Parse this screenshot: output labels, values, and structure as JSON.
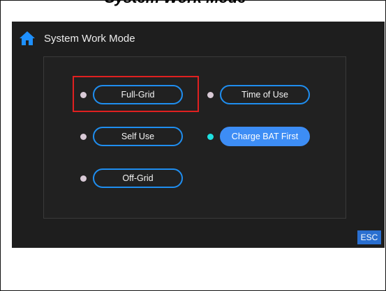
{
  "header": {
    "caption": "System Work Mode"
  },
  "screen": {
    "title": "System Work Mode",
    "home_icon": "home-icon"
  },
  "modes": [
    {
      "label": "Full-Grid",
      "selected": false,
      "highlighted": true
    },
    {
      "label": "Time of Use",
      "selected": false,
      "highlighted": false
    },
    {
      "label": "Self Use",
      "selected": false,
      "highlighted": false
    },
    {
      "label": "Charge BAT First",
      "selected": true,
      "highlighted": false
    },
    {
      "label": "Off-Grid",
      "selected": false,
      "highlighted": false
    }
  ],
  "footer": {
    "esc_label": "ESC"
  },
  "colors": {
    "screen_bg": "#1e1e1e",
    "pill_border": "#1f8ef0",
    "selected_fill": "#3d8df5",
    "active_dot": "#1ee0e0",
    "inactive_dot": "#d8c9d6",
    "highlight_box": "#e02020",
    "esc_bg": "#2a6fd0"
  }
}
